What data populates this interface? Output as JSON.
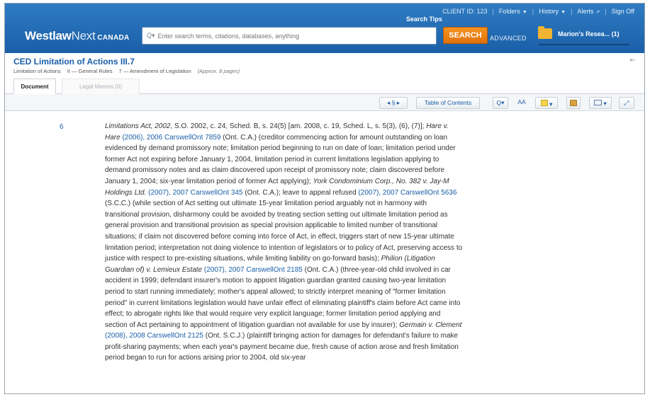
{
  "header": {
    "client_id": "CLIENT ID: 123",
    "folders": "Folders",
    "history": "History",
    "alerts": "Alerts",
    "signoff": "Sign Off",
    "search_tips": "Search Tips",
    "logo_westlaw": "Westlaw",
    "logo_next": "Next",
    "logo_canada": "CANADA",
    "search_placeholder": "Enter search terms, citations, databases, anything",
    "search_button": "SEARCH",
    "advanced": "ADVANCED",
    "folder_label": "Marion's Resea... (1)"
  },
  "document": {
    "title": "CED Limitation of Actions III.7",
    "breadcrumb": [
      "Limitation of Actions",
      "II — General Rules",
      "7 — Amendment of Legislation"
    ],
    "approx": "(Approx. 8 pages)"
  },
  "tabs": {
    "document": "Document",
    "legal_memos": "Legal Memos (0)"
  },
  "toolbar": {
    "section": "◂ § ▸",
    "toc": "Table of Contents",
    "search": "Q▾",
    "aa": "AA"
  },
  "footnote": {
    "number": "6",
    "segments": [
      {
        "t": "Limitations Act, 2002",
        "i": true
      },
      {
        "t": ", S.O. 2002, c. 24, Sched. B, s. 24(5) [am. 2008, c. 19, Sched. L, s. 5(3), (6), (7)]; "
      },
      {
        "t": "Hare v. Hare",
        "i": true
      },
      {
        "t": " "
      },
      {
        "t": "(2006), 2006 CarswellOnt 7859",
        "l": true
      },
      {
        "t": " (Ont. C.A.) (creditor commencing action for amount outstanding on loan evidenced by demand promissory note; limitation period beginning to run on date of loan; limitation period under former Act not expiring before January 1, 2004, limitation period in current limitations legislation applying to demand promissory notes and as claim discovered upon receipt of promissory note; claim discovered before January 1, 2004; six-year limitation period of former Act applying); "
      },
      {
        "t": "York Condominium Corp., No. 382 v. Jay-M Holdings Ltd.",
        "i": true
      },
      {
        "t": " "
      },
      {
        "t": "(2007), 2007 CarswellOnt 345",
        "l": true
      },
      {
        "t": " (Ont. C.A.); leave to appeal refused "
      },
      {
        "t": "(2007), 2007 CarswellOnt 5636",
        "l": true
      },
      {
        "t": " (S.C.C.) (while section of Act setting out ultimate 15-year limitation period arguably not in harmony with transitional provision, disharmony could be avoided by treating section setting out ultimate limitation period as general provision and transitional provision as special provision applicable to limited number of transitional situations; if claim not discovered before coming into force of Act, in effect, triggers start of new 15-year ultimate limitation period; interpretation not doing violence to intention of legislators or to policy of Act, preserving access to justice with respect to pre-existing situations, while limiting liability on go-forward basis); "
      },
      {
        "t": "Philion (Litigation Guardian of) v. Lemieux Estate",
        "i": true
      },
      {
        "t": " "
      },
      {
        "t": "(2007), 2007 CarswellOnt 2185",
        "l": true
      },
      {
        "t": " (Ont. C.A.) (three-year-old child involved in car accident in 1999; defendant insurer's motion to appoint litigation guardian granted causing two-year limitation period to start running immediately; mother's appeal allowed; to strictly interpret meaning of \"former limitation period\" in current limitations legislation would have unfair effect of eliminating plaintiff's claim before Act came into effect; to abrogate rights like that would require very explicit language; former limitation period applying and section of Act pertaining to appointment of litigation guardian not available for use by insurer); "
      },
      {
        "t": "Germain v. Clement",
        "i": true
      },
      {
        "t": " "
      },
      {
        "t": "(2008), 2008 CarswellOnt 2125",
        "l": true
      },
      {
        "t": " (Ont. S.C.J.) (plaintiff bringing action for damages for defendant's failure to make profit-sharing payments; when each year's payment became due, fresh cause of action arose and fresh limitation period began to run for actions arising prior to 2004, old six-year"
      }
    ]
  }
}
